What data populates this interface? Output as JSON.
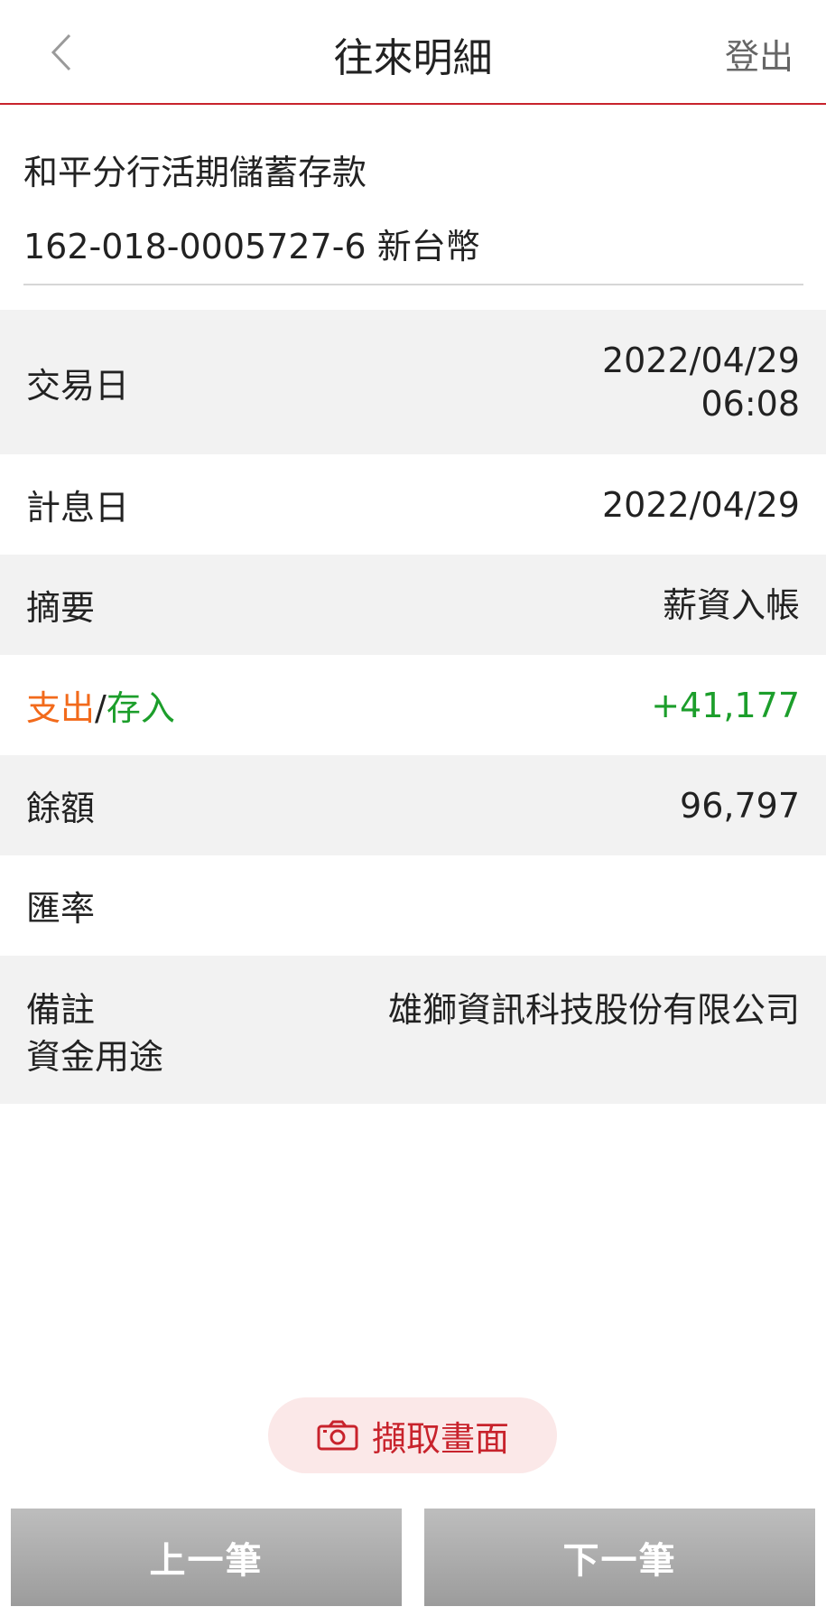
{
  "header": {
    "title": "往來明細",
    "logout_label": "登出"
  },
  "account": {
    "name": "和平分行活期儲蓄存款",
    "number_line": "162-018-0005727-6 新台幣"
  },
  "rows": {
    "trade_date": {
      "label": "交易日",
      "date": "2022/04/29",
      "time": "06:08"
    },
    "value_date": {
      "label": "計息日",
      "value": "2022/04/29"
    },
    "summary": {
      "label": "摘要",
      "value": "薪資入帳"
    },
    "flow": {
      "label_out": "支出",
      "separator": "/",
      "label_in": "存入",
      "value": "+41,177"
    },
    "balance": {
      "label": "餘額",
      "value": "96,797"
    },
    "rate": {
      "label": "匯率",
      "value": ""
    },
    "memo": {
      "label1": "備註",
      "label2": "資金用途",
      "value": "雄獅資訊科技股份有限公司"
    }
  },
  "actions": {
    "capture_label": "擷取畫面",
    "prev_label": "上一筆",
    "next_label": "下一筆"
  },
  "colors": {
    "accent": "#c8232c",
    "deposit": "#1c9e2b",
    "withdraw": "#f26a1b"
  }
}
